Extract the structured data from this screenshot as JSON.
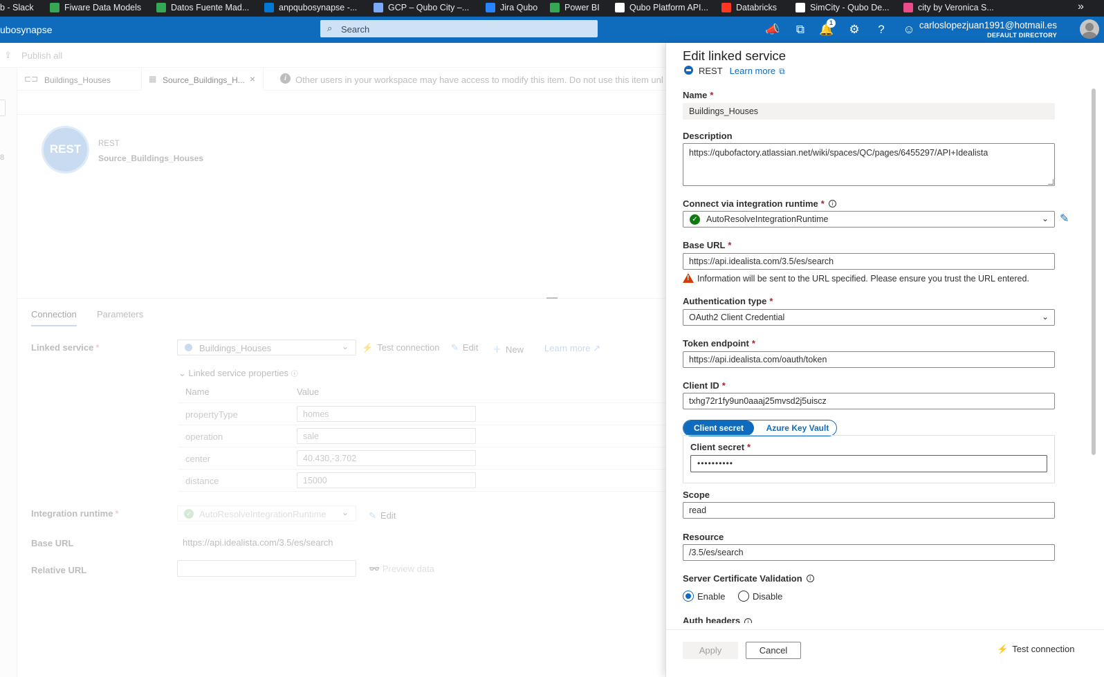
{
  "bookmarks": [
    {
      "label": "b - Slack",
      "icon": "slack-icon",
      "color": "#202124"
    },
    {
      "label": "Fiware Data Models",
      "icon": "sheets-icon",
      "color": "#34a853"
    },
    {
      "label": "Datos Fuente Mad...",
      "icon": "sheets-icon",
      "color": "#34a853"
    },
    {
      "label": "anpqubosynapse -...",
      "icon": "synapse-icon",
      "color": "#0078d4"
    },
    {
      "label": "GCP – Qubo City –...",
      "icon": "table-icon",
      "color": "#7baaf7"
    },
    {
      "label": "Jira Qubo",
      "icon": "jira-icon",
      "color": "#2684ff"
    },
    {
      "label": "Power BI",
      "icon": "powerbi-icon",
      "color": "#34a853"
    },
    {
      "label": "Qubo Platform API...",
      "icon": "github-icon",
      "color": "#ffffff"
    },
    {
      "label": "Databricks",
      "icon": "databricks-icon",
      "color": "#ff3621"
    },
    {
      "label": "SimCity - Qubo De...",
      "icon": "notion-icon",
      "color": "#ffffff"
    },
    {
      "label": "city by Veronica S...",
      "icon": "dribbble-icon",
      "color": "#ea4c89"
    }
  ],
  "bookmarks_more": "»",
  "header": {
    "app_name": "ubosynapse",
    "search_placeholder": "Search",
    "notification_count": "1",
    "user_email": "carloslopezjuan1991@hotmail.es",
    "user_directory": "DEFAULT DIRECTORY"
  },
  "toolbar": {
    "publish_all": "Publish all"
  },
  "left_nav": {
    "partial_number": "8"
  },
  "tabs": [
    {
      "label": "Buildings_Houses"
    },
    {
      "label": "Source_Buildings_H..."
    }
  ],
  "info_bar": {
    "text": "Other users in your workspace may have access to modify this item. Do not use this item unl"
  },
  "activity": {
    "icon_text": "REST",
    "type": "REST",
    "name": "Source_Buildings_Houses"
  },
  "properties_tabs": {
    "connection": "Connection",
    "parameters": "Parameters"
  },
  "connection": {
    "linked_service_label": "Linked service",
    "linked_service_value": "Buildings_Houses",
    "test_connection": "Test connection",
    "edit": "Edit",
    "new": "New",
    "learn_more": "Learn more",
    "linked_service_properties": "Linked service properties",
    "col_name": "Name",
    "col_value": "Value",
    "params": [
      {
        "name": "propertyType",
        "value": "homes"
      },
      {
        "name": "operation",
        "value": "sale"
      },
      {
        "name": "center",
        "value": "40.430,-3.702"
      },
      {
        "name": "distance",
        "value": "15000"
      }
    ],
    "integration_runtime_label": "Integration runtime",
    "integration_runtime_value": "AutoResolveIntegrationRuntime",
    "ir_edit": "Edit",
    "base_url_label": "Base URL",
    "base_url_value": "https://api.idealista.com/3.5/es/search",
    "relative_url_label": "Relative URL",
    "preview_data": "Preview data"
  },
  "panel": {
    "title": "Edit linked service",
    "type": "REST",
    "learn_more": "Learn more",
    "name_label": "Name",
    "name_value": "Buildings_Houses",
    "description_label": "Description",
    "description_value": "https://qubofactory.atlassian.net/wiki/spaces/QC/pages/6455297/API+Idealista",
    "ir_label": "Connect via integration runtime",
    "ir_value": "AutoResolveIntegrationRuntime",
    "base_url_label": "Base URL",
    "base_url_value": "https://api.idealista.com/3.5/es/search",
    "warning": "Information will be sent to the URL specified. Please ensure you trust the URL entered.",
    "auth_type_label": "Authentication type",
    "auth_type_value": "OAuth2 Client Credential",
    "token_endpoint_label": "Token endpoint",
    "token_endpoint_value": "https://api.idealista.com/oauth/token",
    "client_id_label": "Client ID",
    "client_id_value": "txhg72r1fy9un0aaaj25mvsd2j5uiscz",
    "toggle_secret": "Client secret",
    "toggle_keyvault": "Azure Key Vault",
    "client_secret_label": "Client secret",
    "client_secret_value": "••••••••••",
    "scope_label": "Scope",
    "scope_value": "read",
    "resource_label": "Resource",
    "resource_value": "/3.5/es/search",
    "cert_validation_label": "Server Certificate Validation",
    "enable": "Enable",
    "disable": "Disable",
    "auth_headers_label": "Auth headers",
    "apply": "Apply",
    "cancel": "Cancel",
    "test_connection": "Test connection"
  }
}
